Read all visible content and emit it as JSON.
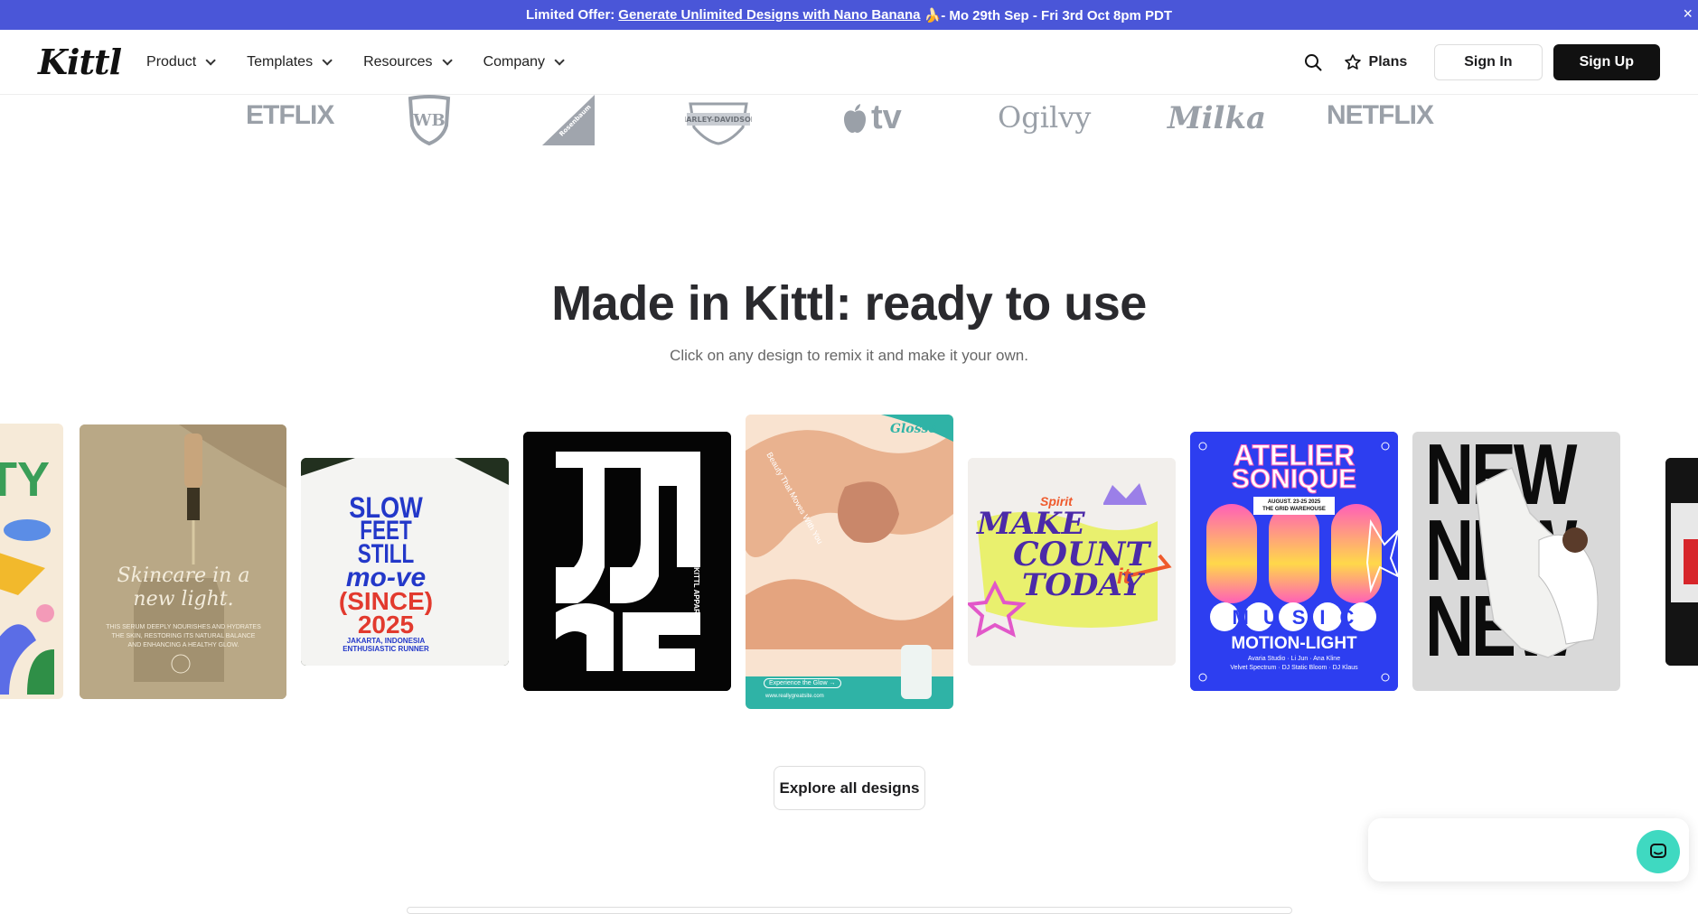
{
  "promo": {
    "prefix": "Limited Offer:",
    "link": "Generate Unlimited Designs with Nano Banana",
    "suffix": "🍌- Mo 29th Sep - Fri 3rd Oct 8pm PDT",
    "close": "×"
  },
  "nav": {
    "logo": "Kittl",
    "menu": [
      {
        "label": "Product"
      },
      {
        "label": "Templates"
      },
      {
        "label": "Resources"
      },
      {
        "label": "Company"
      }
    ],
    "plans": "Plans",
    "sign_in": "Sign In",
    "sign_up": "Sign Up"
  },
  "logos": [
    "ETFLIX",
    "WB",
    "Rosenbaum",
    "MOTOR HARLEY-DAVIDSON CYCLES",
    "tv",
    "Ogilvy",
    "Milka",
    "NETFLIX"
  ],
  "hero": {
    "title": "Made in Kittl: ready to use",
    "subtitle": "Click on any design to remix it and make it your own."
  },
  "designs": {
    "beauty_text": "TY",
    "skincare_title": "Skincare in a new light.",
    "skincare_body": "THIS SERUM DEEPLY NOURISHES AND HYDRATES THE SKIN, RESTORING ITS NATURAL BALANCE AND ENHANCING A HEALTHY GLOW.",
    "slow_line1": "SLOW",
    "slow_line2": "FEET STILL",
    "slow_line3": "mo-ve",
    "slow_line4": "(SINCE)",
    "slow_line5": "2025",
    "slow_line6": "JAKARTA, INDONESIA",
    "slow_line7": "ENTHUSIASTIC RUNNER",
    "justme_side": "KITTL APPAREL",
    "glosse_brand": "Glossé",
    "glosse_tagline": "Beauty That Moves With You",
    "glosse_cta": "Experience the Glow →",
    "glosse_url": "www.reallygreatsite.com",
    "make_line1": "Spirit",
    "make_line2": "MAKE",
    "make_line3": "COUNT",
    "make_line4": "TODAY",
    "make_line5": "it",
    "atelier_line1": "ATELIER",
    "atelier_line2": "SONIQUE",
    "atelier_date": "AUGUST. 23-25 2025",
    "atelier_venue": "THE GRID WAREHOUSE",
    "atelier_music": "MUSIC",
    "atelier_motion": "MOTION-LIGHT",
    "atelier_artists": "Avaria Studio · Li Jun · Ana Kline",
    "atelier_artists2": "Velvet Spectrum · DJ Static Bloom · DJ Klaus",
    "new_word": "NEW"
  },
  "explore_button": "Explore all designs",
  "colors": {
    "promo_bg": "#4a56d8",
    "accent_chat": "#3fd9c1",
    "atelier_bg": "#2d3ef0",
    "slow_blue": "#2338c9",
    "slow_red": "#e23a2e"
  }
}
